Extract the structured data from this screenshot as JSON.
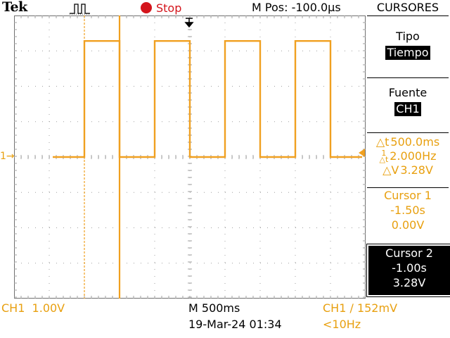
{
  "header": {
    "brand": "Tek",
    "trigger_icon": "pulse-trigger-icon",
    "run_state": "Stop",
    "position": "M Pos: -100.0µs"
  },
  "menu": {
    "title": "CURSORES",
    "type_label": "Tipo",
    "type_value": "Tiempo",
    "source_label": "Fuente",
    "source_value": "CH1"
  },
  "readouts": {
    "delta_t": "500.0ms",
    "inv_delta_t": "2.000Hz",
    "delta_v": "3.28V",
    "cursor1": {
      "label": "Cursor 1",
      "time": "-1.50s",
      "volt": "0.00V"
    },
    "cursor2": {
      "label": "Cursor 2",
      "time": "-1.00s",
      "volt": "3.28V"
    }
  },
  "footer": {
    "ch1_scale": "CH1  1.00V",
    "timebase": "M 500ms",
    "datetime": "19-Mar-24 01:34",
    "trigger": "CH1 ∕ 152mV",
    "frequency": "<10Hz"
  },
  "channel_marker": "1",
  "colors": {
    "trace": "#f0a020",
    "cursor": "#f0a020",
    "grid": "#a0a0a0",
    "stop": "#d4151c"
  },
  "waveform": {
    "low_volts": 0.0,
    "high_volts": 3.28,
    "volts_per_div": 1.0,
    "time_per_div_ms": 500,
    "segments": [
      {
        "start_div": 1.1,
        "end_div": 2.0,
        "level": "low"
      },
      {
        "start_div": 2.0,
        "end_div": 3.0,
        "level": "high"
      },
      {
        "start_div": 3.0,
        "end_div": 4.0,
        "level": "low"
      },
      {
        "start_div": 4.0,
        "end_div": 5.0,
        "level": "high"
      },
      {
        "start_div": 5.0,
        "end_div": 6.0,
        "level": "low"
      },
      {
        "start_div": 6.0,
        "end_div": 7.0,
        "level": "high"
      },
      {
        "start_div": 7.0,
        "end_div": 8.0,
        "level": "low"
      },
      {
        "start_div": 8.0,
        "end_div": 9.0,
        "level": "high"
      },
      {
        "start_div": 9.0,
        "end_div": 9.9,
        "level": "low"
      }
    ],
    "cursor1_div": 2.0,
    "cursor2_div": 3.0
  }
}
